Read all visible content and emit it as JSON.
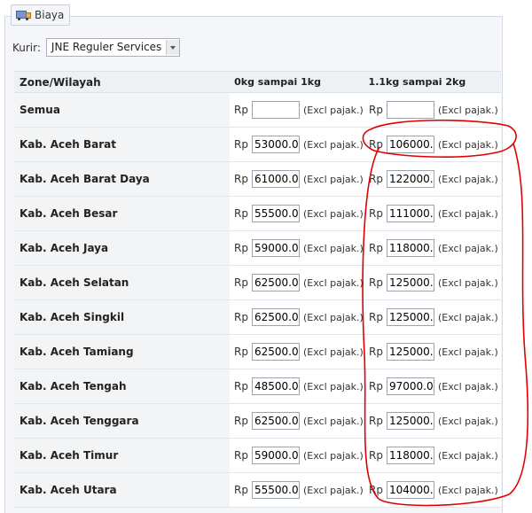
{
  "legend": {
    "title": "Biaya",
    "icon": "truck-icon"
  },
  "kurir": {
    "label": "Kurir:",
    "selected": "JNE Reguler Services"
  },
  "table": {
    "headers": {
      "zone": "Zone/Wilayah",
      "col1": "0kg sampai 1kg",
      "col2": "1.1kg sampai 2kg"
    },
    "currency": "Rp",
    "excl_label": "(Excl pajak.)",
    "rows": [
      {
        "zone": "Semua",
        "v1": "",
        "v2": ""
      },
      {
        "zone": "Kab. Aceh Barat",
        "v1": "53000.0",
        "v2": "106000."
      },
      {
        "zone": "Kab. Aceh Barat Daya",
        "v1": "61000.0",
        "v2": "122000."
      },
      {
        "zone": "Kab. Aceh Besar",
        "v1": "55500.0",
        "v2": "111000."
      },
      {
        "zone": "Kab. Aceh Jaya",
        "v1": "59000.0",
        "v2": "118000."
      },
      {
        "zone": "Kab. Aceh Selatan",
        "v1": "62500.0",
        "v2": "125000."
      },
      {
        "zone": "Kab. Aceh Singkil",
        "v1": "62500.0",
        "v2": "125000."
      },
      {
        "zone": "Kab. Aceh Tamiang",
        "v1": "62500.0",
        "v2": "125000."
      },
      {
        "zone": "Kab. Aceh Tengah",
        "v1": "48500.0",
        "v2": "97000.0"
      },
      {
        "zone": "Kab. Aceh Tenggara",
        "v1": "62500.0",
        "v2": "125000."
      },
      {
        "zone": "Kab. Aceh Timur",
        "v1": "59000.0",
        "v2": "118000."
      },
      {
        "zone": "Kab. Aceh Utara",
        "v1": "55500.0",
        "v2": "104000."
      }
    ]
  },
  "colors": {
    "annotation": "#e00000",
    "zone_bg": "#f2f4f6",
    "panel_bg": "#f4f6f9"
  }
}
